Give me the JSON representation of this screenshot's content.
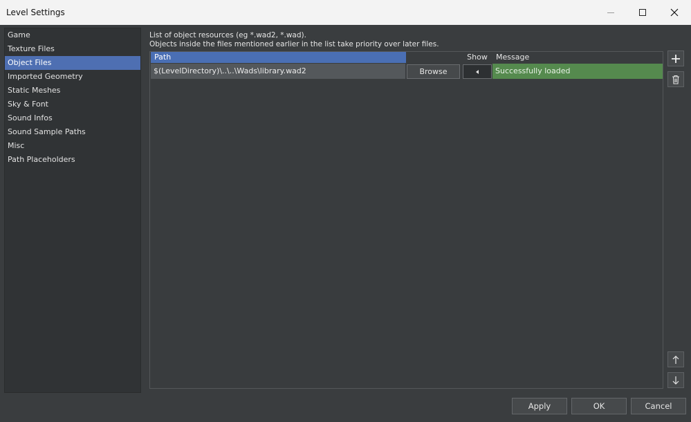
{
  "window": {
    "title": "Level Settings"
  },
  "nav": {
    "items": [
      {
        "label": "Game"
      },
      {
        "label": "Texture Files"
      },
      {
        "label": "Object Files",
        "active": true
      },
      {
        "label": "Imported Geometry"
      },
      {
        "label": "Static Meshes"
      },
      {
        "label": "Sky & Font"
      },
      {
        "label": "Sound Infos"
      },
      {
        "label": "Sound Sample Paths"
      },
      {
        "label": "Misc"
      },
      {
        "label": "Path Placeholders"
      }
    ]
  },
  "main": {
    "description_line1": "List of object resources (eg *.wad2, *.wad).",
    "description_line2": "Objects inside the files mentioned earlier in the list take priority over later files.",
    "columns": {
      "path": "Path",
      "show": "Show",
      "message": "Message"
    },
    "rows": [
      {
        "path": "$(LevelDirectory)\\..\\..\\Wads\\library.wad2",
        "browse_label": "Browse",
        "message": "Successfully loaded"
      }
    ]
  },
  "icons": {
    "add": "plus-icon",
    "delete": "trash-icon",
    "up": "arrow-up-icon",
    "down": "arrow-down-icon",
    "show": "triangle-left-icon"
  },
  "footer": {
    "apply_label": "Apply",
    "ok_label": "OK",
    "cancel_label": "Cancel"
  },
  "colors": {
    "selection": "#4e6fb2",
    "success": "#558a4e"
  }
}
